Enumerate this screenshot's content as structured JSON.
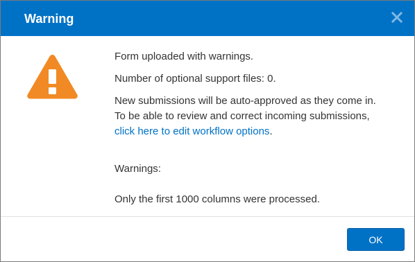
{
  "dialog": {
    "title": "Warning",
    "colors": {
      "header": "#0072c6",
      "warning_icon": "#f18a24",
      "link": "#0072c6",
      "button": "#0072c6"
    },
    "icons": {
      "close": "close-icon",
      "warning": "warning-triangle-icon"
    },
    "messages": {
      "line1": "Form uploaded with warnings.",
      "line2": "Number of optional support files: 0.",
      "line3": "New submissions will be auto-approved as they come in.",
      "line4": "To be able to review and correct incoming submissions,",
      "link_text": "click here to edit workflow options",
      "link_suffix": ".",
      "warnings_label": "Warnings:",
      "warning_detail": "Only the first 1000 columns were processed."
    },
    "ok_label": "OK"
  }
}
